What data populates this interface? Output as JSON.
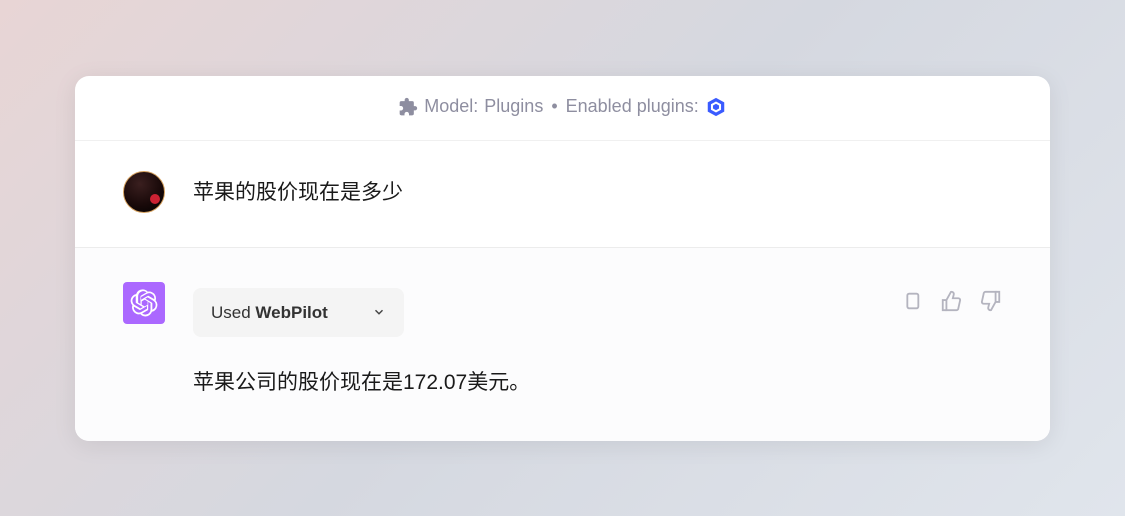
{
  "header": {
    "model_prefix": "Model:",
    "model_value": "Plugins",
    "enabled_label": "Enabled plugins:"
  },
  "user_message": {
    "text": "苹果的股价现在是多少"
  },
  "assistant_message": {
    "plugin_used_prefix": "Used",
    "plugin_name": "WebPilot",
    "answer_prefix": "苹果公司的股价现在是",
    "answer_value": "172.07",
    "answer_suffix": "美元。"
  }
}
